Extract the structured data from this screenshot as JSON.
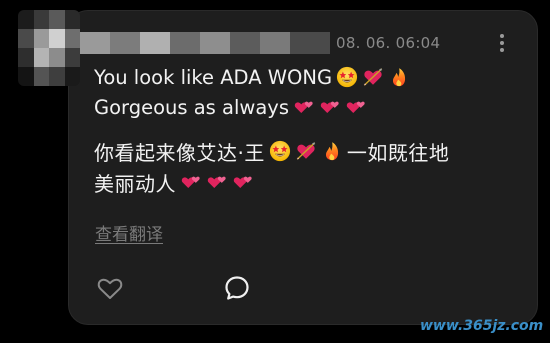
{
  "comment": {
    "timestamp": "08. 06. 06:04",
    "line1_text": "You look like ADA WONG",
    "line2_text": "Gorgeous as always",
    "line3_text": "你看起来像艾达·王",
    "line3_tail": "一如既往地",
    "line4_text": "美丽动人",
    "translate_label": "查看翻译"
  },
  "icons": {
    "avatar": "avatar-blurred",
    "more": "more-vertical-icon",
    "like": "heart-outline-icon",
    "reply": "speech-bubble-icon",
    "emoji_star_eyes": "star-struck-emoji",
    "emoji_heart_arrow": "heart-with-arrow-emoji",
    "emoji_fire": "fire-emoji",
    "emoji_two_hearts": "two-hearts-emoji"
  },
  "watermark": "www.365jz.com",
  "colors": {
    "card_bg": "#1e1e1e",
    "text": "#f2f2f2",
    "muted": "#8a8a8a",
    "heart_red": "#e0245e",
    "fire_orange": "#ff8a1f"
  }
}
